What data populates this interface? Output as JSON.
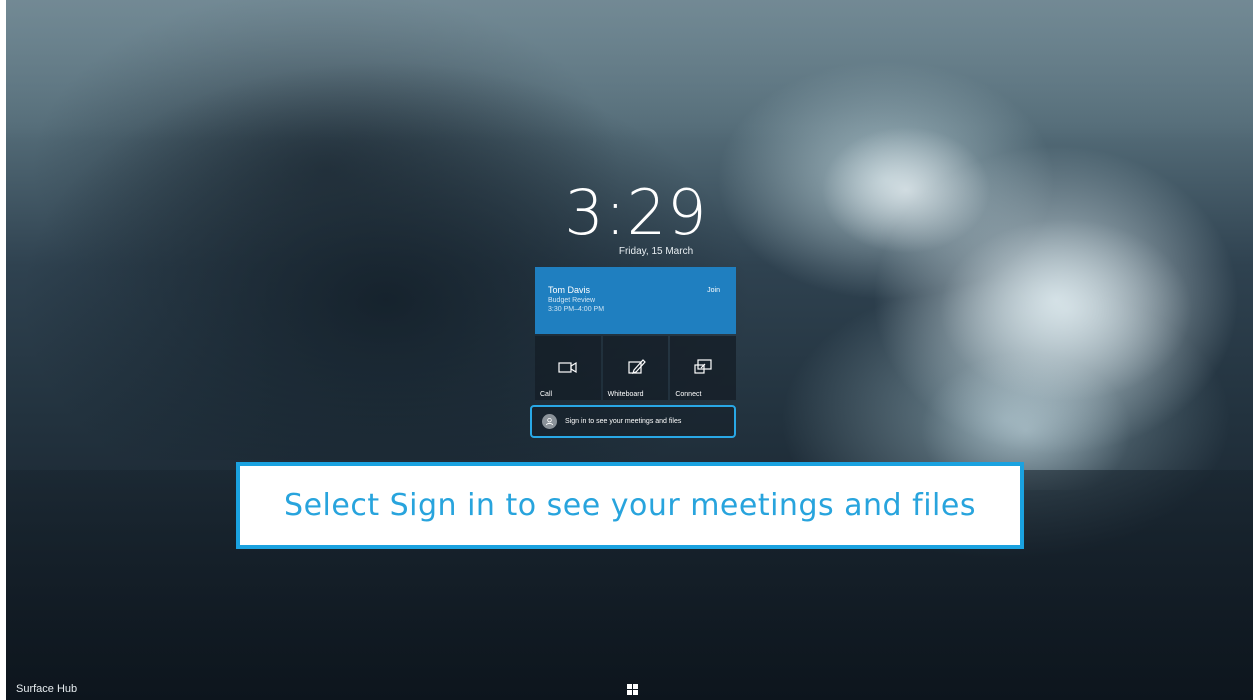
{
  "lock_screen": {
    "time": "3:29",
    "date": "Friday, 15 March"
  },
  "meeting": {
    "organizer": "Tom Davis",
    "title": "Budget Review",
    "time_range": "3:30 PM–4:00 PM",
    "join_label": "Join",
    "color": "#1f7fc0"
  },
  "actions": [
    {
      "label": "Call",
      "icon": "video-camera-icon"
    },
    {
      "label": "Whiteboard",
      "icon": "pen-edit-icon"
    },
    {
      "label": "Connect",
      "icon": "screen-project-icon"
    }
  ],
  "signin": {
    "label": "Sign in to see your meetings and files",
    "highlight_color": "#29a8e6"
  },
  "callout": {
    "text": "Select Sign in to see your meetings and files",
    "border_color": "#1aa2e0"
  },
  "footer": {
    "device_name": "Surface Hub"
  }
}
